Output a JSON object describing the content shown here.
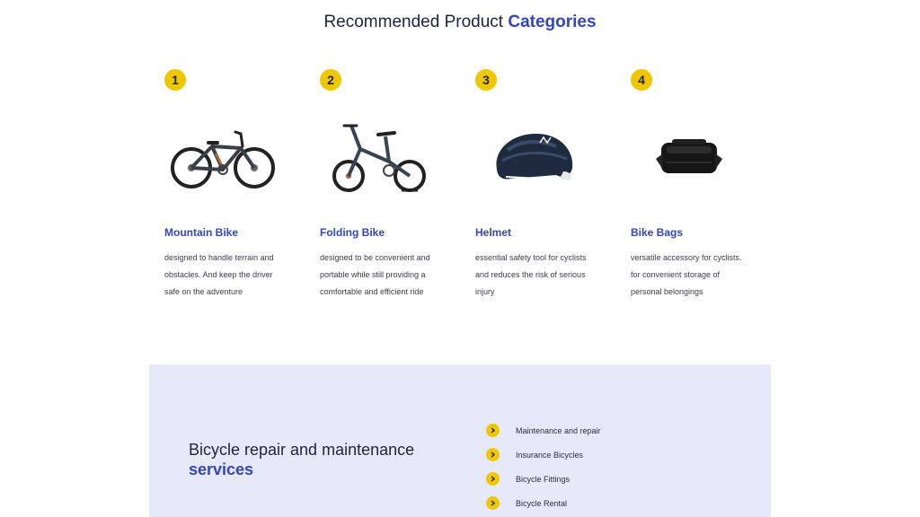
{
  "header": {
    "title_prefix": "Recommended Product",
    "title_accent": "Categories"
  },
  "categories": [
    {
      "number": "1",
      "title": "Mountain Bike",
      "description": "designed to handle terrain and obstacles. And keep the driver safe on the adventure",
      "icon": "mountain-bike-image"
    },
    {
      "number": "2",
      "title": "Folding Bike",
      "description": "designed to be convenient and portable while still providing a comfortable and efficient ride",
      "icon": "folding-bike-image"
    },
    {
      "number": "3",
      "title": "Helmet",
      "description": "essential safety tool for cyclists and reduces the risk of serious injury",
      "icon": "helmet-image"
    },
    {
      "number": "4",
      "title": "Bike Bags",
      "description": "versatile accessory for cyclists. for convenient storage of personal belongings",
      "icon": "bike-bag-image"
    }
  ],
  "services": {
    "heading_prefix": "Bicycle repair and maintenance",
    "heading_accent": "services",
    "items": [
      {
        "label": "Maintenance and repair"
      },
      {
        "label": "Insurance Bicycles"
      },
      {
        "label": "Bicycle Fittings"
      },
      {
        "label": "Bicycle Rental"
      }
    ]
  },
  "colors": {
    "accent_blue": "#3447b8",
    "badge_yellow": "#efc700",
    "services_bg": "#e6e9f9",
    "heading_dark": "#1f2340"
  }
}
